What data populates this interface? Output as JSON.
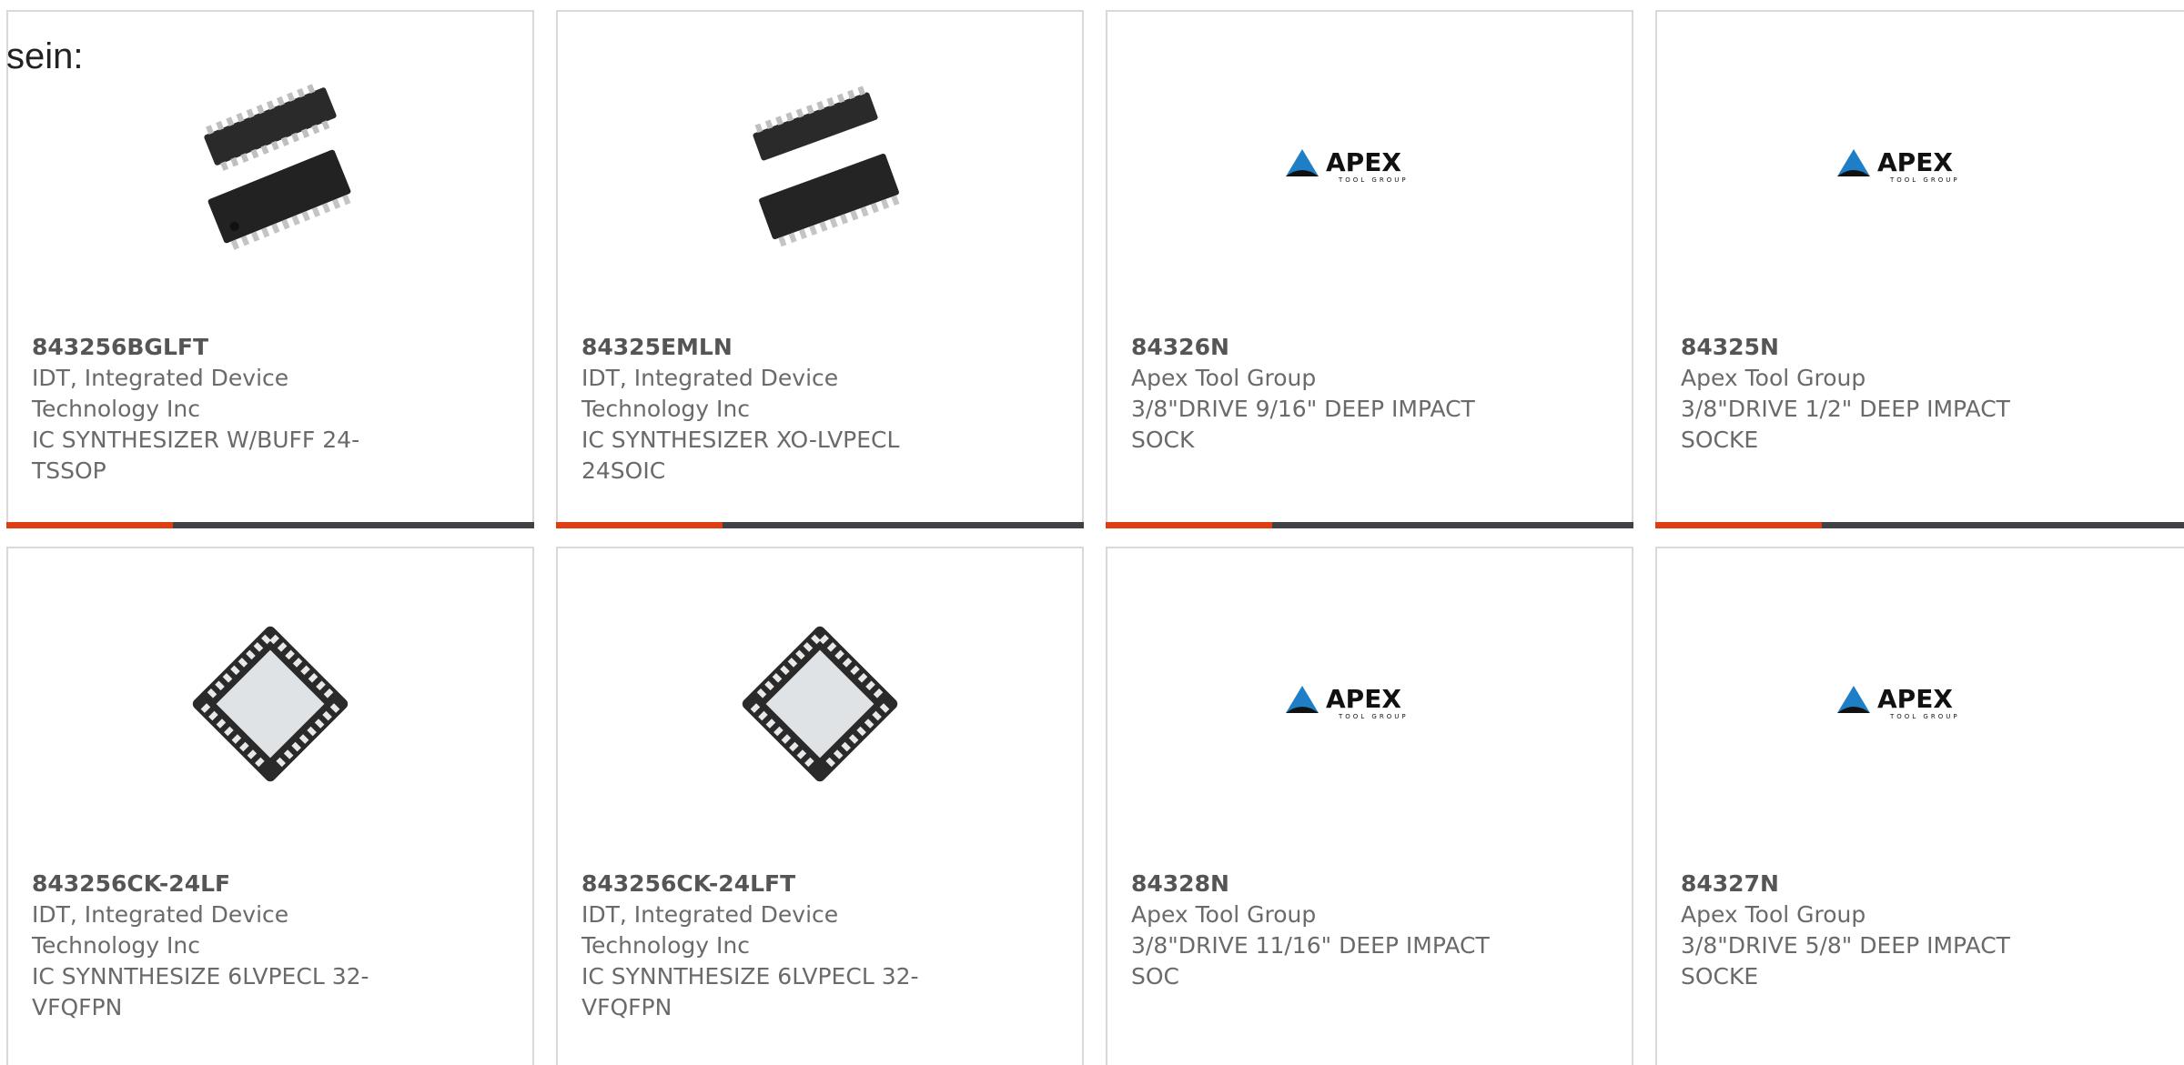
{
  "lead_text": "sein:",
  "accent_color": "#e03d12",
  "bar_color": "#3f4144",
  "products": [
    {
      "part": "843256BGLFT",
      "maker": "IDT, Integrated Device Technology Inc",
      "desc": "IC SYNTHESIZER W/BUFF 24-TSSOP",
      "image": "tssop-chip-image"
    },
    {
      "part": "84325EMLN",
      "maker": "IDT, Integrated Device Technology Inc",
      "desc": "IC SYNTHESIZER XO-LVPECL 24SOIC",
      "image": "soic-chip-image"
    },
    {
      "part": "84326N",
      "maker": "Apex Tool Group",
      "desc": "3/8\"DRIVE 9/16\" DEEP IMPACT SOCK",
      "image": "apex-logo"
    },
    {
      "part": "84325N",
      "maker": "Apex Tool Group",
      "desc": "3/8\"DRIVE 1/2\" DEEP IMPACT SOCKE",
      "image": "apex-logo"
    },
    {
      "part": "843256CK-24LF",
      "maker": "IDT, Integrated Device Technology Inc",
      "desc": "IC SYNNTHESIZE 6LVPECL 32-VFQFPN",
      "image": "qfn-chip-image"
    },
    {
      "part": "843256CK-24LFT",
      "maker": "IDT, Integrated Device Technology Inc",
      "desc": "IC SYNNTHESIZE 6LVPECL 32-VFQFPN",
      "image": "qfn-chip-image"
    },
    {
      "part": "84328N",
      "maker": "Apex Tool Group",
      "desc": "3/8\"DRIVE 11/16\" DEEP IMPACT SOC",
      "image": "apex-logo"
    },
    {
      "part": "84327N",
      "maker": "Apex Tool Group",
      "desc": "3/8\"DRIVE 5/8\" DEEP IMPACT SOCKE",
      "image": "apex-logo"
    }
  ],
  "logo_text": {
    "brand": "APEX",
    "tag": "TOOL GROUP"
  }
}
